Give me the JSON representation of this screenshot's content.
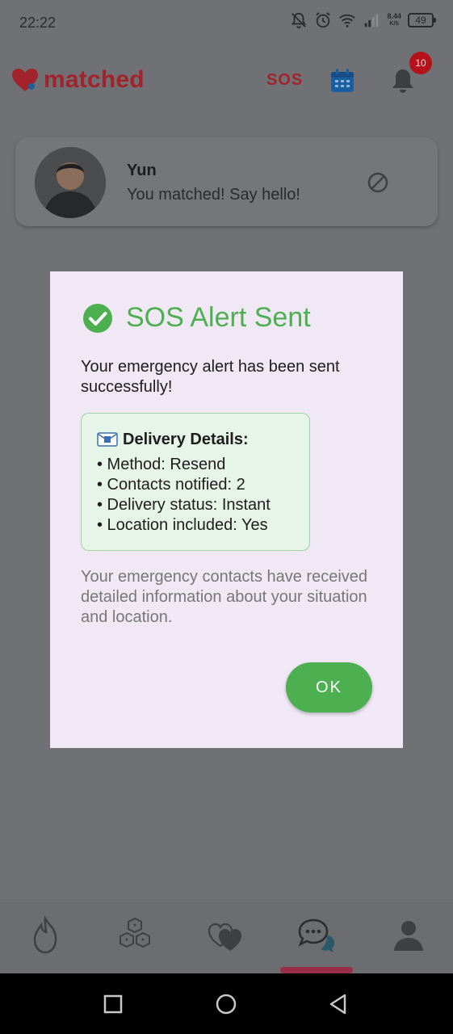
{
  "status_bar": {
    "time": "22:22",
    "net_speed_value": "8.44",
    "net_speed_unit": "K/S",
    "battery": "49"
  },
  "header": {
    "logo_text": "matched",
    "sos_label": "SOS",
    "notification_count": "10",
    "colors": {
      "brand": "#a3232c",
      "calendar": "#1b5e9e",
      "badge": "#b5121b"
    }
  },
  "match_card": {
    "name": "Yun",
    "message": "You matched! Say hello!"
  },
  "dialog": {
    "title": "SOS Alert Sent",
    "body": "Your emergency alert has been sent successfully!",
    "details_title": "Delivery Details:",
    "details": [
      "• Method: Resend",
      "• Contacts notified: 2",
      "• Delivery status: Instant",
      "• Location included: Yes"
    ],
    "note": "Your emergency contacts have received detailed information about your situation and location.",
    "ok_label": "OK",
    "colors": {
      "success": "#4caf50",
      "details_bg": "#e6f5e7"
    }
  },
  "bottom_nav": {
    "items": [
      "flame-icon",
      "cubes-icon",
      "hearts-icon",
      "chat-icon",
      "profile-icon"
    ],
    "active_index": 3
  }
}
